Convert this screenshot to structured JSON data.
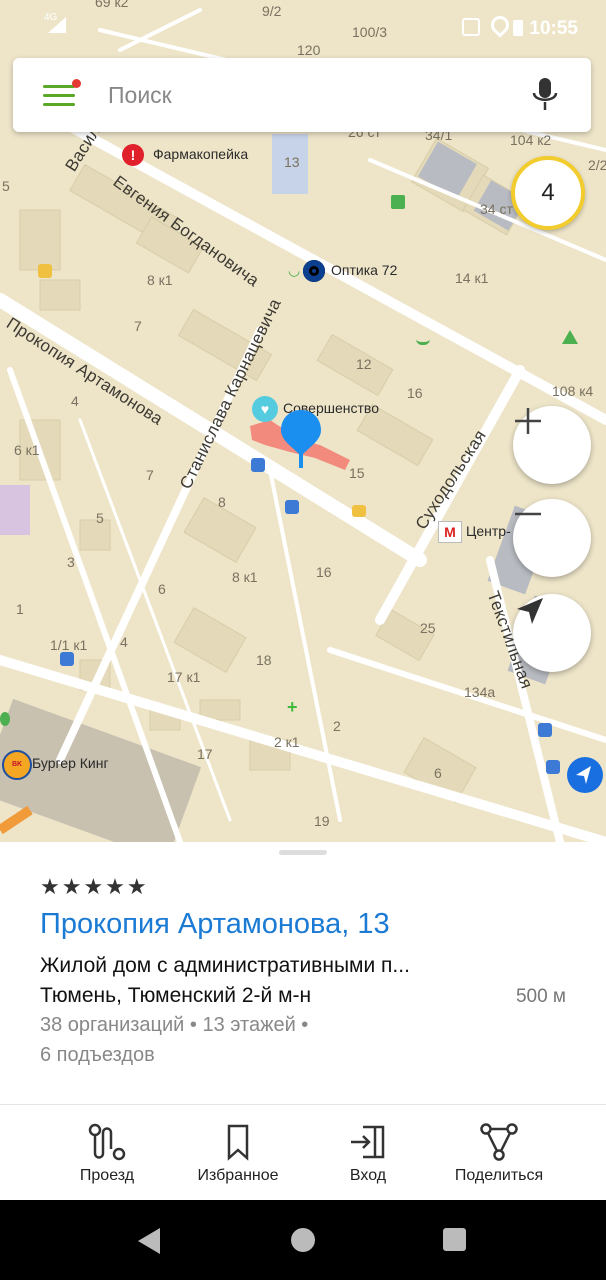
{
  "status_bar": {
    "network": "4G",
    "time": "10:55"
  },
  "search": {
    "placeholder": "Поиск"
  },
  "map": {
    "traffic_score": "4",
    "streets": [
      "Василия",
      "Евгения Богдановича",
      "Прокопия Артамонова",
      "Станислава Карнацевича",
      "Суходольская",
      "Текстильная"
    ],
    "pois": [
      "Фармакопейка",
      "Оптика 72",
      "Совершенство",
      "Центр-",
      "Бургер Кинг"
    ],
    "house_numbers": [
      "69 к2",
      "9/2",
      "100/3",
      "120",
      "34/1",
      "104 к2",
      "2/2",
      "13",
      "34 ст",
      "8 к1",
      "14 к1",
      "7",
      "12",
      "108 к4",
      "4",
      "16",
      "6 к1",
      "15",
      "8",
      "5",
      "3",
      "8 к1",
      "16",
      "6",
      "1",
      "25",
      "1/1 к1",
      "4",
      "17 к1",
      "18",
      "134а",
      "2",
      "2 к1",
      "17",
      "6",
      "19",
      "5",
      "26 ст"
    ]
  },
  "card": {
    "rating": "★★★★★",
    "title": "Прокопия Артамонова, 13",
    "type": "Жилой дом с административными п...",
    "location": "Тюмень, Тюменский 2-й м-н",
    "distance": "500 м",
    "details": "38 организаций • 13 этажей •",
    "entrances": "6 подъездов"
  },
  "actions": [
    {
      "label": "Проезд",
      "icon": "route-icon"
    },
    {
      "label": "Избранное",
      "icon": "bookmark-icon"
    },
    {
      "label": "Вход",
      "icon": "entrance-icon"
    },
    {
      "label": "Поделиться",
      "icon": "share-icon"
    }
  ]
}
